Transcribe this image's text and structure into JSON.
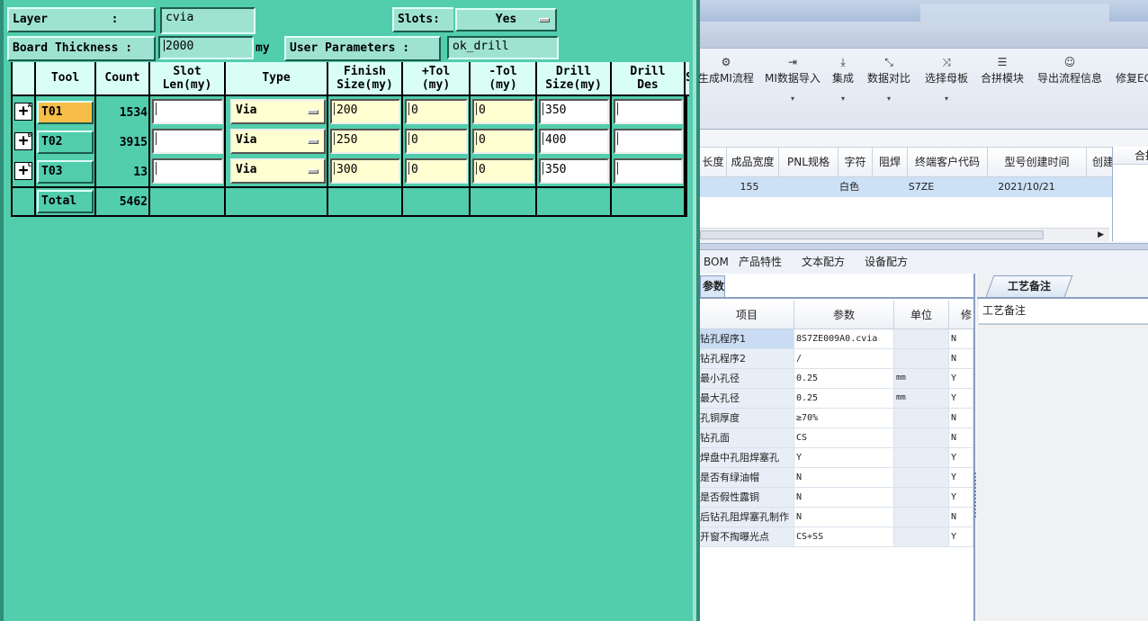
{
  "drill_dialog": {
    "layer_label": "Layer         :",
    "layer_value": "cvia",
    "slots_label": "Slots:",
    "slots_value": "Yes",
    "thickness_label": "Board Thickness :",
    "thickness_value": "2000",
    "thickness_unit": "my",
    "user_params_label": "User Parameters :",
    "user_params_value": "ok_drill",
    "headers": [
      "Tool",
      "Count",
      "Slot\nLen(my)",
      "Type",
      "Finish\nSize(my)",
      "+Tol\n(my)",
      "-Tol\n(my)",
      "Drill\nSize(my)",
      "Drill\nDes",
      "S"
    ],
    "rows": [
      {
        "badge": "A",
        "tool": "T01",
        "count": "1534",
        "slot": "",
        "type": "Via",
        "finish": "200",
        "ptol": "0",
        "mtol": "0",
        "drill": "350",
        "des": ""
      },
      {
        "badge": "B",
        "tool": "T02",
        "count": "3915",
        "slot": "",
        "type": "Via",
        "finish": "250",
        "ptol": "0",
        "mtol": "0",
        "drill": "400",
        "des": ""
      },
      {
        "badge": "C",
        "tool": "T03",
        "count": "13",
        "slot": "",
        "type": "Via",
        "finish": "300",
        "ptol": "0",
        "mtol": "0",
        "drill": "350",
        "des": ""
      }
    ],
    "total_label": "Total",
    "total_count": "5462"
  },
  "mi_app": {
    "ribbon": [
      {
        "icon": "⚙",
        "label": "生成MI流程",
        "arrow": ""
      },
      {
        "icon": "⇥",
        "label": "MI数据导入",
        "arrow": "▾"
      },
      {
        "icon": "⤓",
        "label": "集成",
        "arrow": "▾"
      },
      {
        "icon": "⤡",
        "label": "数据对比",
        "arrow": "▾"
      },
      {
        "icon": "⤨",
        "label": "选择母板",
        "arrow": "▾"
      },
      {
        "icon": "☰",
        "label": "合拼模块",
        "arrow": ""
      },
      {
        "icon": "☺",
        "label": "导出流程信息",
        "arrow": ""
      },
      {
        "icon": "",
        "label": "修复EC",
        "arrow": ""
      }
    ],
    "top_grid": {
      "headers": [
        "长度",
        "成品宽度",
        "PNL规格",
        "字符",
        "阻焊",
        "终端客户代码",
        "型号创建时间",
        "创建"
      ],
      "row": [
        "",
        "155",
        "",
        "白色",
        "",
        "S7ZE",
        "2021/10/21",
        ""
      ]
    },
    "side_grid_header": "合拼",
    "bottom_tabs": [
      "BOM",
      "产品特性",
      "文本配方",
      "设备配方"
    ],
    "param_tab": "参数",
    "param_headers": [
      "项目",
      "参数",
      "单位",
      "修"
    ],
    "params": [
      {
        "item": "钻孔程序1",
        "value": "8S7ZE009A0.cvia",
        "unit": "",
        "flag": "N"
      },
      {
        "item": "钻孔程序2",
        "value": "/",
        "unit": "",
        "flag": "N"
      },
      {
        "item": "最小孔径",
        "value": "0.25",
        "unit": "mm",
        "flag": "Y"
      },
      {
        "item": "最大孔径",
        "value": "0.25",
        "unit": "mm",
        "flag": "Y"
      },
      {
        "item": "孔铜厚度",
        "value": "≥70%",
        "unit": "",
        "flag": "N"
      },
      {
        "item": "钻孔面",
        "value": "CS",
        "unit": "",
        "flag": "N"
      },
      {
        "item": "焊盘中孔阻焊塞孔",
        "value": "Y",
        "unit": "",
        "flag": "Y"
      },
      {
        "item": "是否有绿油帽",
        "value": "N",
        "unit": "",
        "flag": "Y"
      },
      {
        "item": "是否假性露铜",
        "value": "N",
        "unit": "",
        "flag": "Y"
      },
      {
        "item": "后钻孔阻焊塞孔制作",
        "value": "N",
        "unit": "",
        "flag": "N"
      },
      {
        "item": "开窗不掏曝光点",
        "value": "CS+SS",
        "unit": "",
        "flag": "Y"
      }
    ],
    "remark_tab": "工艺备注",
    "remark_header": "工艺备注"
  }
}
